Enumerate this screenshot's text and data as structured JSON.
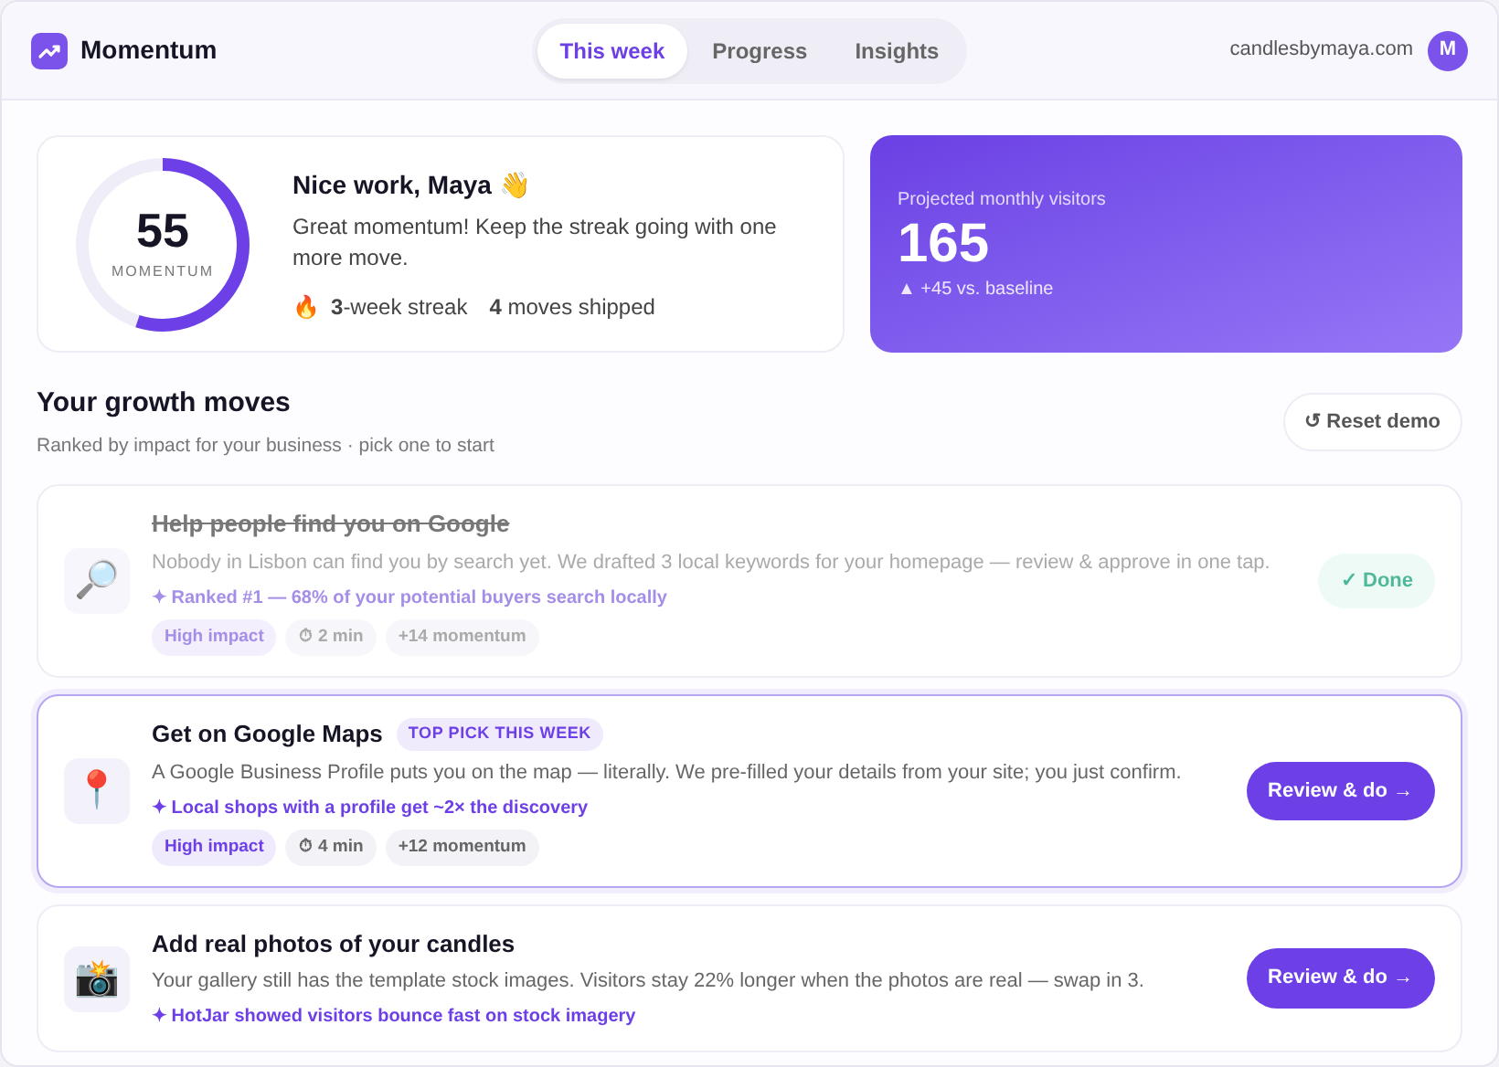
{
  "app": {
    "name": "Momentum"
  },
  "tabs": [
    {
      "label": "This week",
      "selected": true
    },
    {
      "label": "Progress",
      "selected": false
    },
    {
      "label": "Insights",
      "selected": false
    }
  ],
  "account": {
    "domain": "candlesbymaya.com",
    "avatar": "M"
  },
  "score": {
    "value": "55",
    "label": "MOMENTUM",
    "level": 0.55
  },
  "greeting": {
    "title": "Nice work, Maya 👋",
    "message": "Great momentum! Keep the streak going with one more move.",
    "streak_icon": "🔥",
    "streak": "**3**-week streak",
    "shipped": "**4** moves shipped"
  },
  "projection": {
    "label": "Projected monthly visitors",
    "value": "165",
    "delta": "▲ +45 vs. baseline"
  },
  "moves_section": {
    "title": "Your growth moves",
    "subtitle": "Ranked by impact for your business · pick one to start",
    "reset": "↺ Reset demo"
  },
  "moves": [
    {
      "icon": "🔎",
      "title": "Help people find you on Google",
      "done": true,
      "selected": false,
      "description": "Nobody in Lisbon can find you by search yet. We drafted 3 local keywords for your homepage — review & approve in one tap.",
      "insight": "✦ Ranked #1 — 68% of your potential buyers search locally",
      "tags": [
        {
          "kind": "impact",
          "label": "High impact"
        },
        {
          "kind": "plain",
          "label": "⏱ 2 min"
        },
        {
          "kind": "plain",
          "label": "+14 momentum"
        }
      ],
      "action": {
        "kind": "done",
        "label": "✓ Done"
      }
    },
    {
      "icon": "📍",
      "title": "Get on Google Maps",
      "badge": "TOP PICK THIS WEEK",
      "done": false,
      "selected": true,
      "description": "A Google Business Profile puts you on the map — literally. We pre-filled your details from your site; you just confirm.",
      "insight": "✦ Local shops with a profile get ~2× the discovery",
      "tags": [
        {
          "kind": "impact",
          "label": "High impact"
        },
        {
          "kind": "plain",
          "label": "⏱ 4 min"
        },
        {
          "kind": "plain",
          "label": "+12 momentum"
        }
      ],
      "action": {
        "kind": "primary",
        "label": "Review & do →"
      }
    },
    {
      "icon": "📸",
      "title": "Add real photos of your candles",
      "done": false,
      "selected": false,
      "description": "Your gallery still has the template stock images. Visitors stay 22% longer when the photos are real — swap in 3.",
      "insight": "✦ HotJar showed visitors bounce fast on stock imagery",
      "action": {
        "kind": "primary",
        "label": "Review & do →"
      }
    }
  ]
}
